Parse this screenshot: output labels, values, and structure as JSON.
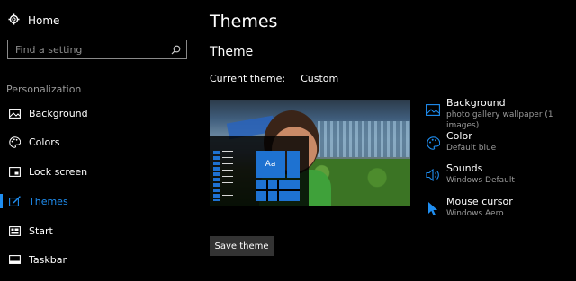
{
  "sidebar": {
    "home_label": "Home",
    "search_placeholder": "Find a setting",
    "section_label": "Personalization",
    "items": [
      {
        "label": "Background",
        "icon": "image-icon"
      },
      {
        "label": "Colors",
        "icon": "palette-icon"
      },
      {
        "label": "Lock screen",
        "icon": "lock-screen-icon"
      },
      {
        "label": "Themes",
        "icon": "brush-icon",
        "active": true
      },
      {
        "label": "Start",
        "icon": "start-icon"
      },
      {
        "label": "Taskbar",
        "icon": "taskbar-icon"
      }
    ]
  },
  "main": {
    "page_title": "Themes",
    "section_title": "Theme",
    "current_theme_label": "Current theme:",
    "current_theme_value": "Custom",
    "preview_tile_label": "Aa",
    "settings": [
      {
        "title": "Background",
        "value": "photo gallery wallpaper (1 images)",
        "icon": "image-icon"
      },
      {
        "title": "Color",
        "value": "Default blue",
        "icon": "palette-icon"
      },
      {
        "title": "Sounds",
        "value": "Windows Default",
        "icon": "speaker-icon"
      },
      {
        "title": "Mouse cursor",
        "value": "Windows Aero",
        "icon": "cursor-icon"
      }
    ],
    "save_button": "Save theme"
  },
  "colors": {
    "accent": "#1f8ef1",
    "background": "#000000",
    "secondary_text": "#9a9a9a",
    "button": "#333333"
  }
}
